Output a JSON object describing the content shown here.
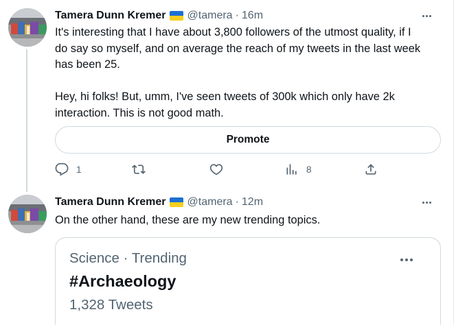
{
  "tweets": [
    {
      "author_name": "Tamera Dunn Kremer",
      "author_flag": "ukraine-flag",
      "handle": "@tamera",
      "separator": "·",
      "time": "16m",
      "text_lines": [
        "It's interesting that I have about 3,800 followers of the utmost quality, if I",
        "do say so myself, and on average the reach of my tweets in the last week",
        "has been 25.",
        "",
        "Hey, hi folks! But, umm, I've seen tweets of 300k which only have 2k",
        "interaction. This is not good math."
      ],
      "promote_label": "Promote",
      "actions": {
        "reply_count": "1",
        "retweet_count": "",
        "like_count": "",
        "views_count": "8"
      }
    },
    {
      "author_name": "Tamera Dunn Kremer",
      "author_flag": "ukraine-flag",
      "handle": "@tamera",
      "separator": "·",
      "time": "12m",
      "text_lines": [
        "On the other hand, these are my new trending topics."
      ],
      "trend_card": {
        "category": "Science",
        "separator": "·",
        "status": "Trending",
        "topic": "#Archaeology",
        "tweet_count": "1,328 Tweets"
      }
    }
  ],
  "colors": {
    "text_primary": "#0f1419",
    "text_secondary": "#536471",
    "border": "#cfd9de",
    "flag_blue": "#1d6fd3",
    "flag_yellow": "#f7cf1f"
  }
}
